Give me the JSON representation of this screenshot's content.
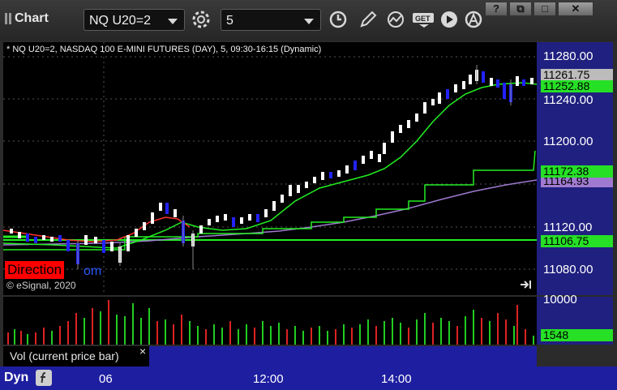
{
  "window": {
    "title": "Chart",
    "help_label": "?",
    "restore_label": "⧉",
    "maximize_label": "□",
    "close_label": "✕"
  },
  "toolbar": {
    "symbol_value": "NQ U20=2",
    "interval_value": "5"
  },
  "chart": {
    "symbol_description": "* NQ U20=2, NASDAQ 100 E-MINI FUTURES (DAY), 5, 09:30-16:15 (Dynamic)",
    "y_ticks": [
      "11280.00",
      "11240.00",
      "11200.00",
      "11120.00",
      "11080.00"
    ],
    "price_tags": [
      {
        "value": "11261.75",
        "color": "#bcbcbc"
      },
      {
        "value": "11252.88",
        "color": "#26e026"
      },
      {
        "value": "11172.38",
        "color": "#26e026"
      },
      {
        "value": "11164.93",
        "color": "#a07ad0"
      },
      {
        "value": "11106.75",
        "color": "#26e026"
      }
    ],
    "watermark_text": "Direction",
    "watermark_suffix": "om",
    "copyright": "© eSignal, 2020"
  },
  "volume": {
    "y_tick": "10000",
    "tag_value": "1548",
    "study_label": "Vol (current price bar)",
    "close_label": "×"
  },
  "x_axis": {
    "ticks": [
      "06",
      "12:00",
      "14:00"
    ]
  },
  "bottom": {
    "dyn_label": "Dyn"
  },
  "colors": {
    "up_candle": "#ffffff",
    "down_candle": "#2222ff",
    "ma_fast": "#22dd22",
    "ma_slow": "#a07ad0",
    "level_line": "#22ee22",
    "vol_up": "#22cc22",
    "vol_down": "#dd2222"
  }
}
